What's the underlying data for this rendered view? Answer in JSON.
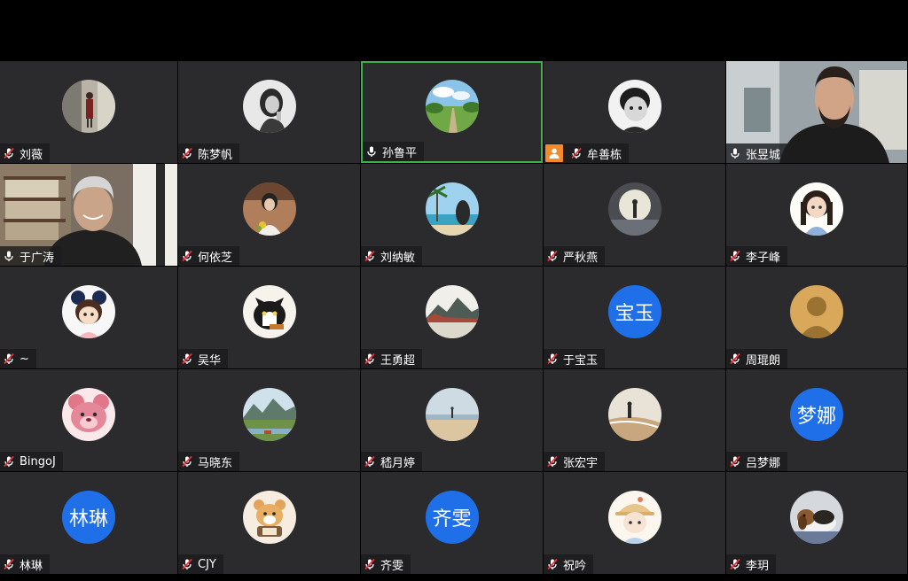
{
  "meeting": {
    "participants": [
      {
        "name": "刘薇",
        "mic": "muted",
        "avatar": "photo-woman-street"
      },
      {
        "name": "陈梦帆",
        "mic": "muted",
        "avatar": "photo-woman-bw"
      },
      {
        "name": "孙鲁平",
        "mic": "on",
        "avatar": "photo-landscape-path",
        "speaking": true
      },
      {
        "name": "牟善栋",
        "mic": "muted",
        "avatar": "photo-child-bw",
        "host_badge": true
      },
      {
        "name": "张昱城",
        "mic": "on",
        "video": true
      },
      {
        "name": "于广涛",
        "mic": "on",
        "video": true
      },
      {
        "name": "何依芝",
        "mic": "muted",
        "avatar": "photo-woman-flowers"
      },
      {
        "name": "刘纳敏",
        "mic": "muted",
        "avatar": "photo-palm-beach"
      },
      {
        "name": "严秋燕",
        "mic": "muted",
        "avatar": "photo-moon-figure"
      },
      {
        "name": "李子峰",
        "mic": "muted",
        "avatar": "cartoon-girl"
      },
      {
        "name": "~",
        "mic": "muted",
        "avatar": "cartoon-mouse-ears"
      },
      {
        "name": "吴华",
        "mic": "muted",
        "avatar": "cartoon-cat"
      },
      {
        "name": "王勇超",
        "mic": "muted",
        "avatar": "painting-landscape"
      },
      {
        "name": "于宝玉",
        "mic": "muted",
        "initials": "宝玉"
      },
      {
        "name": "周琨朗",
        "mic": "muted",
        "avatar": "default-silhouette"
      },
      {
        "name": "BingoJ",
        "mic": "muted",
        "avatar": "cartoon-bear-pink"
      },
      {
        "name": "马晓东",
        "mic": "muted",
        "avatar": "photo-mountains"
      },
      {
        "name": "嵇月婷",
        "mic": "muted",
        "avatar": "photo-beach-sand"
      },
      {
        "name": "张宏宇",
        "mic": "muted",
        "avatar": "photo-beach-person"
      },
      {
        "name": "吕梦娜",
        "mic": "muted",
        "initials": "梦娜"
      },
      {
        "name": "林琳",
        "mic": "muted",
        "initials": "林琳"
      },
      {
        "name": "CJY",
        "mic": "muted",
        "avatar": "cartoon-tiger"
      },
      {
        "name": "齐雯",
        "mic": "muted",
        "initials": "齐雯"
      },
      {
        "name": "祝吟",
        "mic": "muted",
        "avatar": "cartoon-hat-girl"
      },
      {
        "name": "李玥",
        "mic": "muted",
        "avatar": "photo-dog"
      }
    ]
  },
  "colors": {
    "tile_bg": "#2b2b2d",
    "active_border": "#3bb34a",
    "initials_bg": "#1f6fe8",
    "host_badge": "#f48a2a",
    "mute_red": "#e5333b"
  }
}
